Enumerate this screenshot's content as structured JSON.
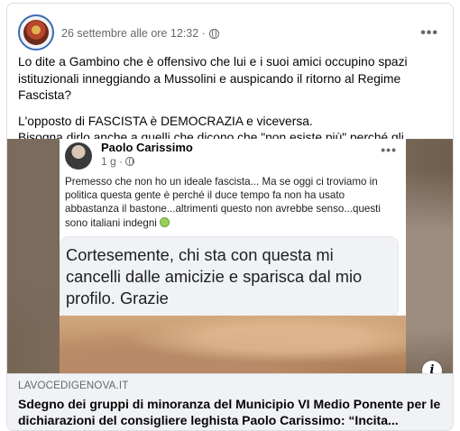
{
  "post": {
    "timestamp": "26 settembre alle ore 12:32 ·",
    "paragraph1": "Lo dite a Gambino che è offensivo che lui e i suoi amici occupino spazi istituzionali inneggiando a Mussolini e auspicando il ritorno al Regime Fascista?",
    "paragraph2_line1": "L'opposto di FASCISTA è DEMOCRAZIA e viceversa.",
    "paragraph2_line2": "Bisogna dirlo anche a quelli che dicono che \"non esiste più\" perché gli hanno spalancato le porte."
  },
  "shared_post": {
    "author": "Paolo Carissimo",
    "time": "1 g ·",
    "text": "Premesso che non ho un ideale fascista... Ma se oggi ci troviamo in politica questa gente è perché il duce tempo fa non ha usato abbastanza il bastone...altrimenti questo non avrebbe senso...questi sono italiani indegni",
    "quote": "Cortesemente, chi sta con questa mi cancelli dalle amicizie e sparisca dal mio profilo. Grazie"
  },
  "link_preview": {
    "domain": "LAVOCEDIGENOVA.IT",
    "title": "Sdegno dei gruppi di minoranza del Municipio VI Medio Ponente per le dichiarazioni del consigliere leghista Paolo Carissimo: “Incita..."
  },
  "icons": {
    "audience": "globe-icon",
    "menu": "more-icon",
    "info": "info-icon"
  }
}
